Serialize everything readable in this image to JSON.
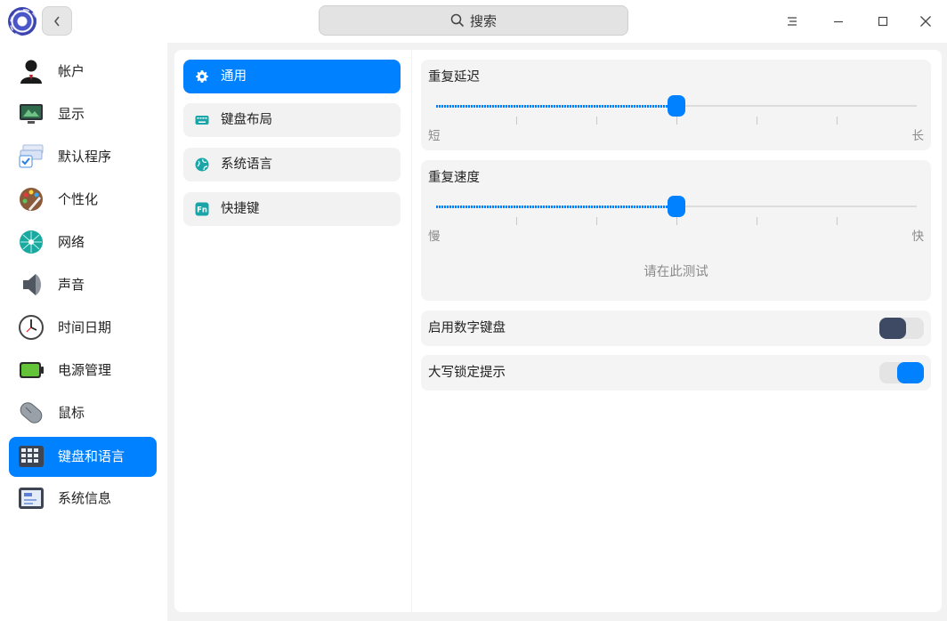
{
  "titlebar": {
    "search_placeholder": "搜索",
    "icons": [
      "app-logo",
      "back-icon",
      "search-icon",
      "menu-icon",
      "minimize-icon",
      "maximize-icon",
      "close-icon"
    ]
  },
  "sidebar": {
    "items": [
      {
        "label": "帐户",
        "icon": "account-icon"
      },
      {
        "label": "显示",
        "icon": "display-icon"
      },
      {
        "label": "默认程序",
        "icon": "default-apps-icon"
      },
      {
        "label": "个性化",
        "icon": "personalization-icon"
      },
      {
        "label": "网络",
        "icon": "network-icon"
      },
      {
        "label": "声音",
        "icon": "sound-icon"
      },
      {
        "label": "时间日期",
        "icon": "clock-icon"
      },
      {
        "label": "电源管理",
        "icon": "battery-icon"
      },
      {
        "label": "鼠标",
        "icon": "mouse-icon"
      },
      {
        "label": "键盘和语言",
        "icon": "keyboard-icon",
        "active": true
      },
      {
        "label": "系统信息",
        "icon": "system-info-icon"
      }
    ]
  },
  "subnav": {
    "items": [
      {
        "label": "通用",
        "icon": "gear-icon",
        "active": true
      },
      {
        "label": "键盘布局",
        "icon": "keyboard-layout-icon"
      },
      {
        "label": "系统语言",
        "icon": "globe-icon"
      },
      {
        "label": "快捷键",
        "icon": "fn-key-icon",
        "icon_text": "Fn"
      }
    ]
  },
  "settings": {
    "repeat_delay": {
      "title": "重复延迟",
      "min_label": "短",
      "max_label": "长",
      "value": 0.5
    },
    "repeat_rate": {
      "title": "重复速度",
      "min_label": "慢",
      "max_label": "快",
      "value": 0.5,
      "test_placeholder": "请在此测试"
    },
    "numpad": {
      "label": "启用数字键盘",
      "enabled": false
    },
    "capslock": {
      "label": "大写锁定提示",
      "enabled": true
    }
  },
  "colors": {
    "accent": "#0081ff",
    "toggle_off_knob": "#3e4a63"
  }
}
